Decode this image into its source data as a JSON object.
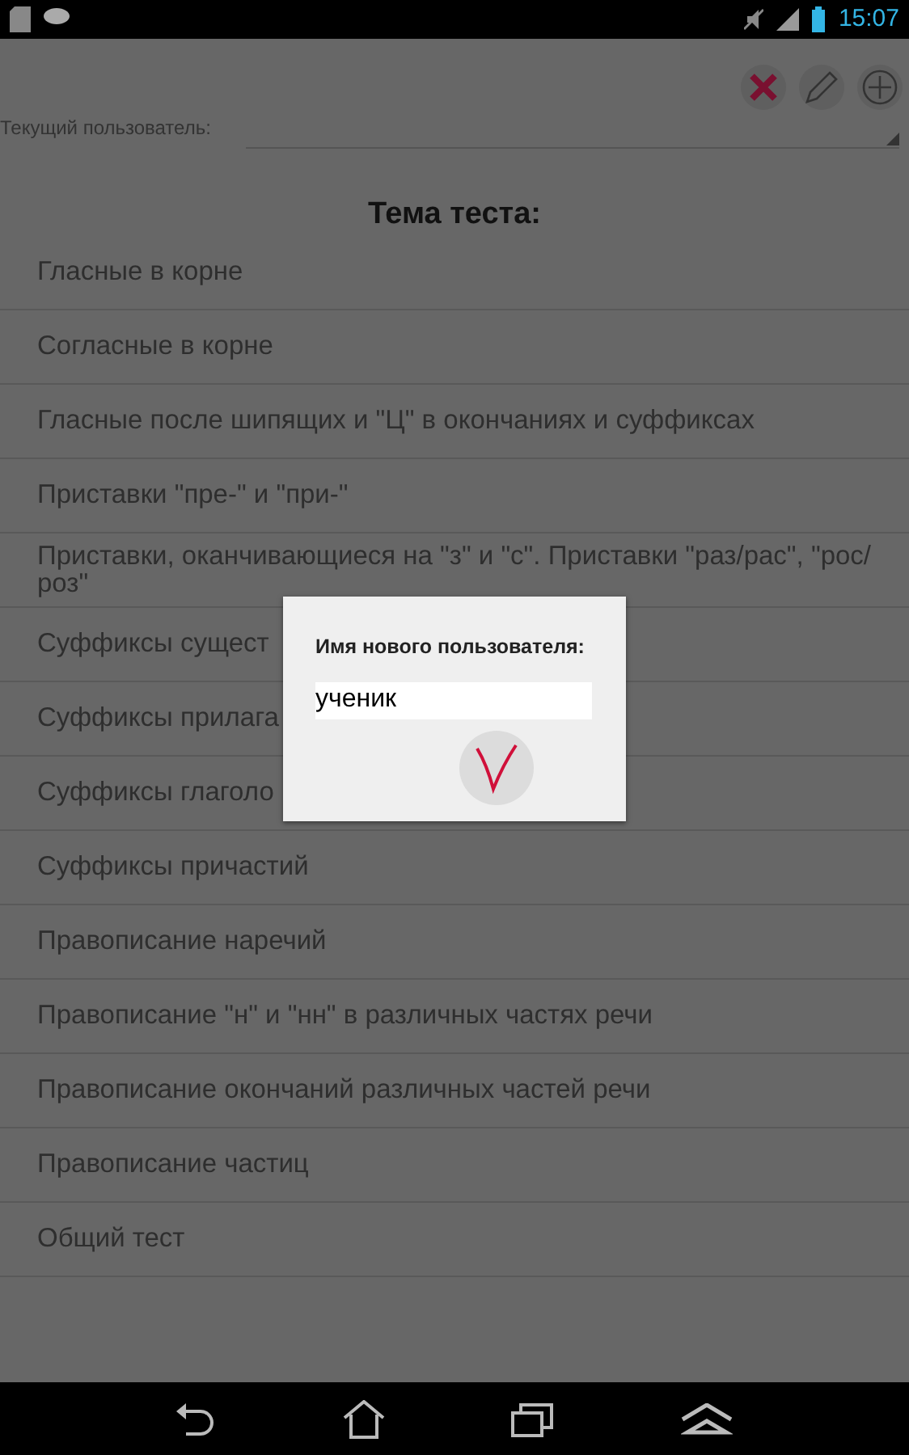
{
  "status_bar": {
    "time": "15:07"
  },
  "current_user": {
    "label": "Текущий пользователь:"
  },
  "title": "Тема теста:",
  "topics": [
    {
      "label": "Гласные в корне"
    },
    {
      "label": "Согласные в корне"
    },
    {
      "label": "Гласные после шипящих и \"Ц\" в окончаниях и суффиксах"
    },
    {
      "label": "Приставки \"пре-\" и \"при-\""
    },
    {
      "label": "Приставки, оканчивающиеся на \"з\" и \"с\". Приставки \"раз/рас\", \"рос/роз\""
    },
    {
      "label": "Суффиксы сущест"
    },
    {
      "label": "Суффиксы прилага"
    },
    {
      "label": "Суффиксы глаголо"
    },
    {
      "label": "Суффиксы причастий"
    },
    {
      "label": "Правописание наречий"
    },
    {
      "label": "Правописание \"н\" и \"нн\" в различных частях речи"
    },
    {
      "label": "Правописание окончаний различных частей речи"
    },
    {
      "label": "Правописание частиц"
    },
    {
      "label": "Общий тест"
    }
  ],
  "dialog": {
    "label": "Имя нового пользователя:",
    "value": "ученик"
  }
}
